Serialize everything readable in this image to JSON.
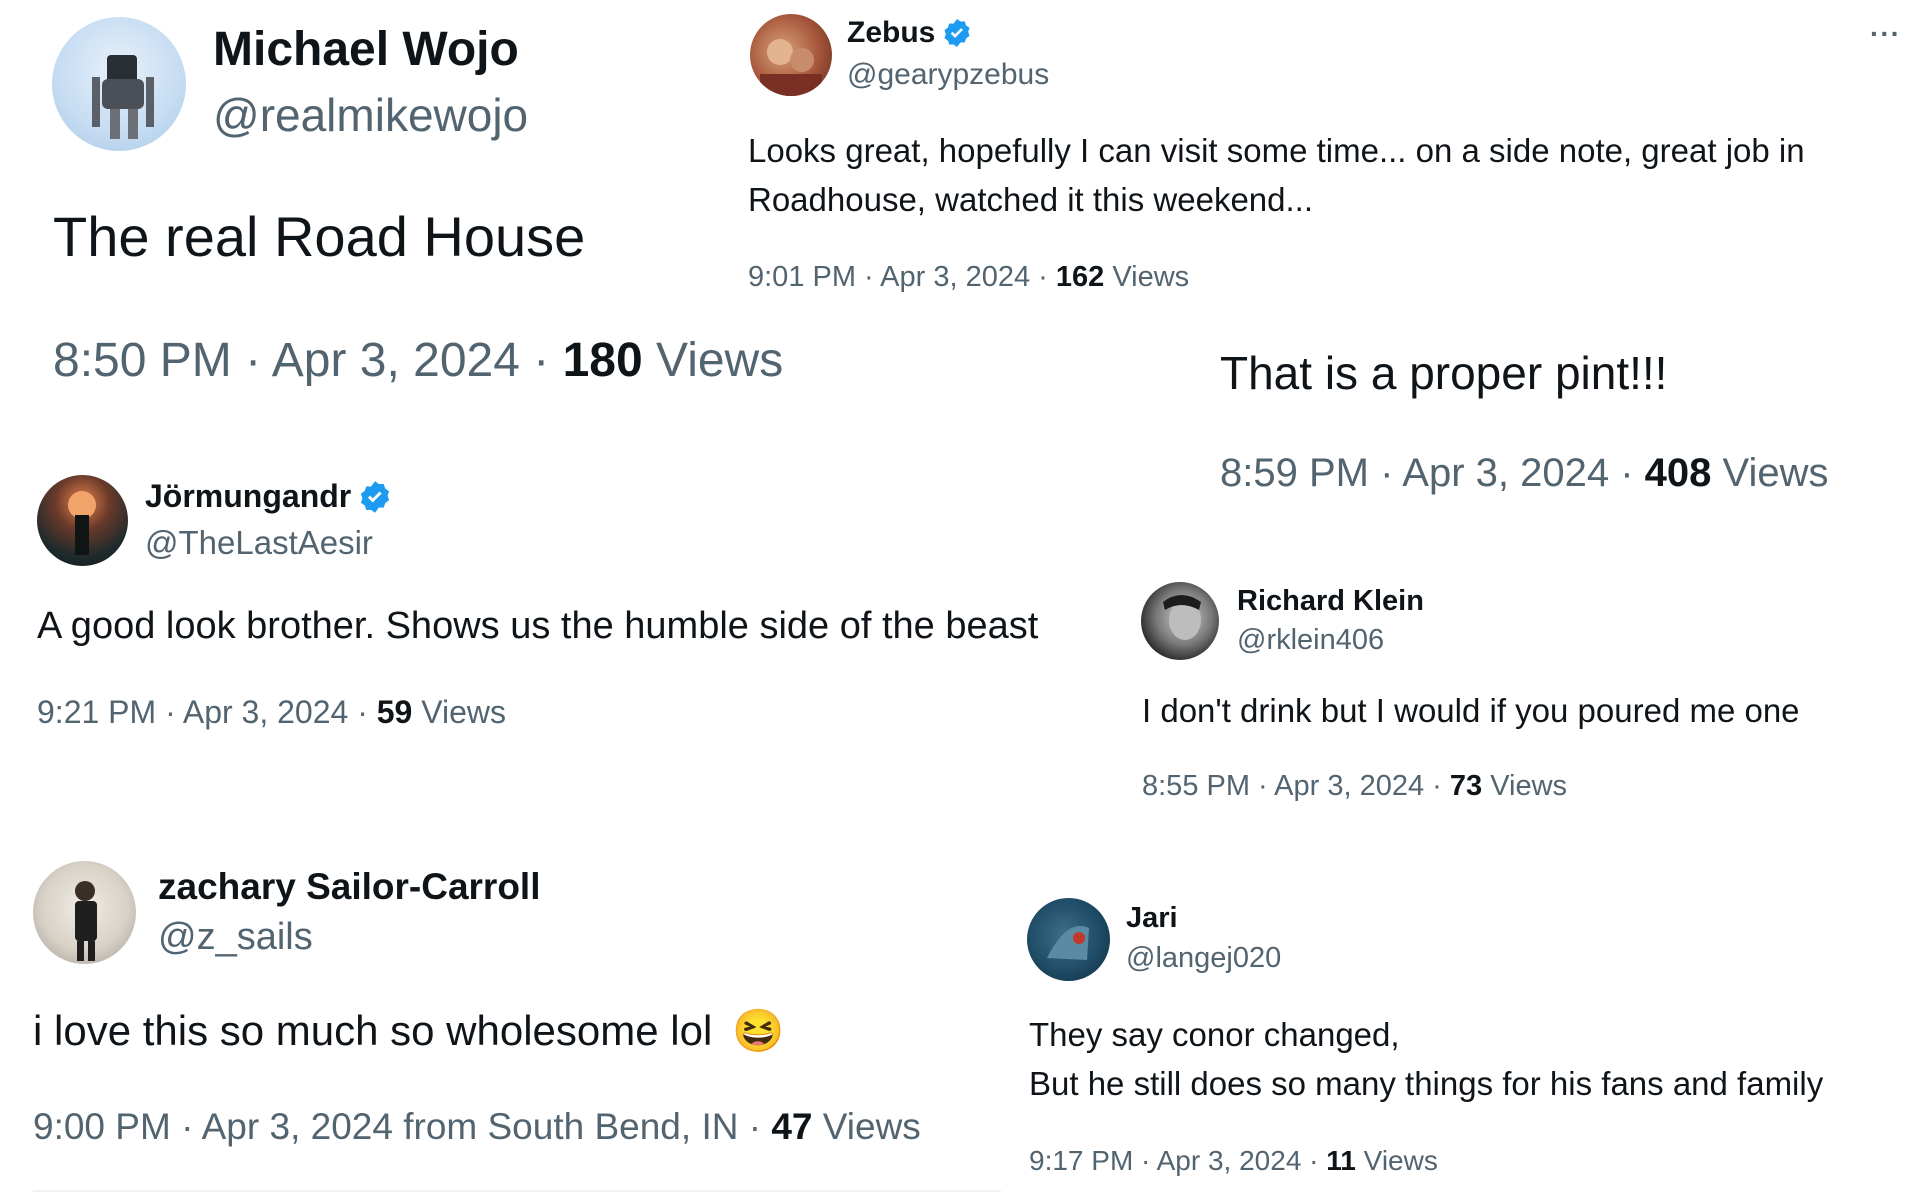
{
  "colors": {
    "text": "#0f1419",
    "secondary": "#536471",
    "verified": "#1d9bf0"
  },
  "tweets": [
    {
      "name": "Michael Wojo",
      "handle": "@realmikewojo",
      "text": "The real Road House",
      "time": "8:50 PM · Apr 3, 2024 · ",
      "views_count": "180",
      "views_label": " Views",
      "verified": false
    },
    {
      "name": "Zebus",
      "handle": "@gearypzebus",
      "text_line1": "Looks great, hopefully I can visit some time... on a side note, great job in",
      "text_line2": "Roadhouse, watched it this weekend...",
      "time": "9:01 PM · Apr 3, 2024 · ",
      "views_count": "162",
      "views_label": " Views",
      "verified": true
    },
    {
      "text": "That is a proper pint!!!",
      "time": "8:59 PM · Apr 3, 2024 · ",
      "views_count": "408",
      "views_label": " Views"
    },
    {
      "name": "Jörmungandr",
      "handle": "@TheLastAesir",
      "text": "A good look brother. Shows us the humble side of the beast",
      "time": "9:21 PM · Apr 3, 2024 · ",
      "views_count": "59",
      "views_label": " Views",
      "verified": true
    },
    {
      "name": "Richard Klein",
      "handle": "@rklein406",
      "text": "I don't drink but I would if you poured me one",
      "time": "8:55 PM · Apr 3, 2024 · ",
      "views_count": "73",
      "views_label": " Views",
      "verified": false
    },
    {
      "name": "zachary Sailor-Carroll",
      "handle": "@z_sails",
      "text": "i love this so much so wholesome lol",
      "emoji": "😆",
      "time": "9:00 PM · Apr 3, 2024 from South Bend, IN · ",
      "views_count": "47",
      "views_label": " Views",
      "verified": false
    },
    {
      "name": "Jari",
      "handle": "@langej020",
      "text_line1": "They say conor changed,",
      "text_line2": "But he still does so many things for his fans and family",
      "time": "9:17 PM · Apr 3, 2024 · ",
      "views_count": "11",
      "views_label": " Views",
      "verified": false
    }
  ],
  "more_menu": "···"
}
